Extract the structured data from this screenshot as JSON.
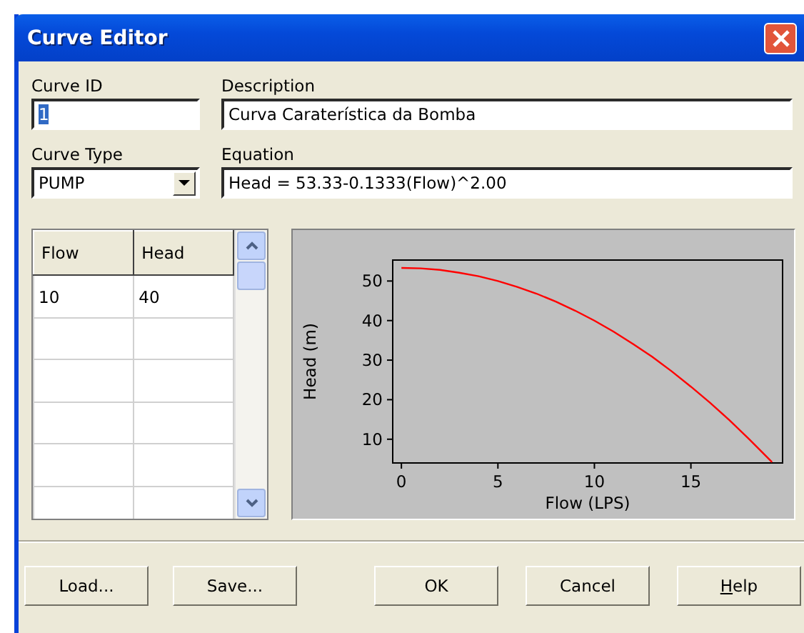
{
  "window": {
    "title": "Curve Editor"
  },
  "curve_id": {
    "label": "Curve ID",
    "value": "1",
    "text_selected": true
  },
  "description": {
    "label": "Description",
    "value": "Curva Caraterística da Bomba"
  },
  "curve_type": {
    "label": "Curve Type",
    "value": "PUMP"
  },
  "equation": {
    "label": "Equation",
    "value": "Head = 53.33-0.1333(Flow)^2.00"
  },
  "table": {
    "columns": [
      "Flow",
      "Head"
    ],
    "rows": [
      {
        "flow": "10",
        "head": "40"
      }
    ]
  },
  "chart_data": {
    "type": "line",
    "xlabel": "Flow (LPS)",
    "ylabel": "Head (m)",
    "xlim": [
      -0.45,
      19.75
    ],
    "ylim": [
      4,
      55.3
    ],
    "xticks": [
      0,
      5,
      10,
      15
    ],
    "yticks": [
      10,
      20,
      30,
      40,
      50
    ],
    "x": [
      0,
      1,
      2,
      3,
      4,
      5,
      6,
      7,
      8,
      9,
      10,
      11,
      12,
      13,
      14,
      15,
      16,
      17,
      18,
      19,
      19.2
    ],
    "series": [
      {
        "color": "#ff0000",
        "values": [
          53.3,
          53.2,
          52.8,
          52.1,
          51.2,
          50,
          48.5,
          46.8,
          44.8,
          42.5,
          40,
          37.2,
          34.1,
          30.8,
          27.2,
          23.3,
          19.2,
          14.8,
          10.1,
          5.2,
          4.2
        ]
      }
    ]
  },
  "buttons": [
    {
      "label": "Load...",
      "mnemonic": false
    },
    {
      "label": "Save...",
      "mnemonic": false
    },
    {
      "label": "OK",
      "mnemonic": false
    },
    {
      "label": "Cancel",
      "mnemonic": false
    },
    {
      "label": "Help",
      "mnemonic": true
    }
  ]
}
